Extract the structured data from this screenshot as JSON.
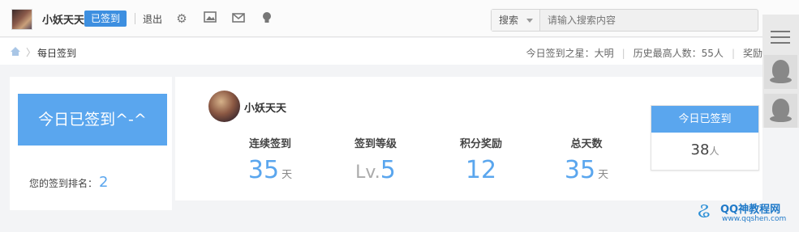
{
  "topbar": {
    "username": "小妖天天",
    "signed_badge": "已签到",
    "logout": "退出",
    "search": {
      "scope": "搜索",
      "placeholder": "请输入搜索内容"
    }
  },
  "breadcrumb": {
    "current": "每日签到"
  },
  "stats": {
    "star": "今日签到之星：大明",
    "max": "历史最高人数：55人",
    "reward": "奖励"
  },
  "left": {
    "signed_button": "今日已签到^-^",
    "rank_label": "您的签到排名：",
    "rank_value": "2"
  },
  "profile": {
    "name": "小妖天天"
  },
  "metrics": [
    {
      "label": "连续签到",
      "value": "35",
      "unit": "天"
    },
    {
      "label": "签到等级",
      "prefix": "Lv.",
      "value": "5",
      "unit": ""
    },
    {
      "label": "积分奖励",
      "value": "12",
      "unit": ""
    },
    {
      "label": "总天数",
      "value": "35",
      "unit": "天"
    }
  ],
  "today": {
    "title": "今日已签到",
    "count": "38",
    "unit": "人"
  },
  "watermark": {
    "line1": "QQ神教程网",
    "line2": "www.qqshen.com"
  },
  "colors": {
    "accent": "#5aa6ee",
    "badge": "#3d8fe0"
  }
}
